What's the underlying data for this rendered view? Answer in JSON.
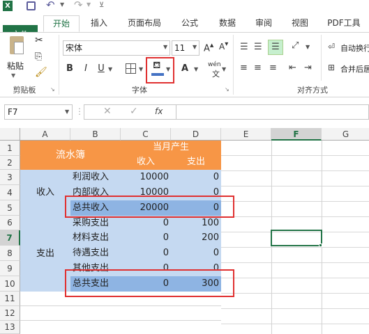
{
  "titlebar": {
    "app_icon": "excel-icon",
    "save_icon": "save-icon",
    "undo_icon": "undo-icon",
    "redo_icon": "redo-icon"
  },
  "tabs": [
    "文件",
    "开始",
    "插入",
    "页面布局",
    "公式",
    "数据",
    "审阅",
    "视图",
    "PDF工具"
  ],
  "ribbon": {
    "clipboard": {
      "paste": "粘贴",
      "group": "剪贴板"
    },
    "font": {
      "name": "宋体",
      "size": "11",
      "bold": "B",
      "italic": "I",
      "underline": "U",
      "font_color": "A",
      "phonetic": "wén",
      "group": "字体"
    },
    "align": {
      "wrap": "自动换行",
      "merge": "合并后居中",
      "group": "对齐方式"
    }
  },
  "formula": {
    "namebox": "F7",
    "fx": "fx",
    "content": ""
  },
  "columns": [
    "A",
    "B",
    "C",
    "D",
    "E",
    "F",
    "G"
  ],
  "rows": [
    "1",
    "2",
    "3",
    "4",
    "5",
    "6",
    "7",
    "8",
    "9",
    "10",
    "11",
    "12",
    "13"
  ],
  "sheet": {
    "title": "流水簿",
    "header_month": "当月产生",
    "header_income": "收入",
    "header_expense": "支出",
    "group_income": "收入",
    "group_expense": "支出",
    "lines": [
      {
        "item": "利润收入",
        "income": "10000",
        "expense": "0"
      },
      {
        "item": "内部收入",
        "income": "10000",
        "expense": "0"
      },
      {
        "item": "总共收入",
        "income": "20000",
        "expense": "0"
      },
      {
        "item": "采购支出",
        "income": "0",
        "expense": "100"
      },
      {
        "item": "材料支出",
        "income": "0",
        "expense": "200"
      },
      {
        "item": "待遇支出",
        "income": "0",
        "expense": "0"
      },
      {
        "item": "其他支出",
        "income": "0",
        "expense": "0"
      },
      {
        "item": "总共支出",
        "income": "0",
        "expense": "300"
      }
    ]
  },
  "colors": {
    "orange": "#f79646",
    "lightblue": "#c5d9f1",
    "darkblue": "#8eb4e3",
    "excel_green": "#217346",
    "red": "#e03030"
  }
}
